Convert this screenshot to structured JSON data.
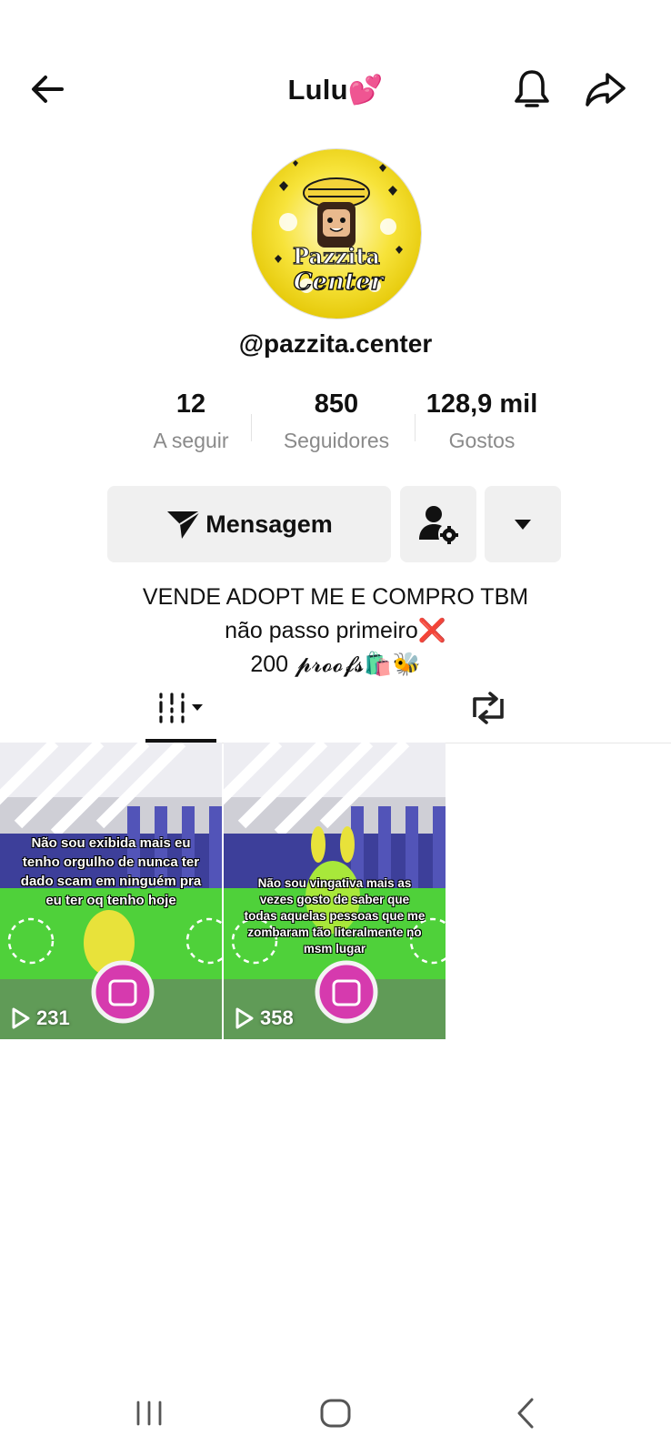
{
  "header": {
    "title": "Lulu💕",
    "back_icon": "arrow-left-icon",
    "bell_icon": "bell-icon",
    "share_icon": "share-arrow-icon"
  },
  "profile": {
    "avatar_text_line1": "Pazzita",
    "avatar_text_line2": "Center",
    "handle": "@pazzita.center"
  },
  "stats": [
    {
      "value": "12",
      "label": "A seguir"
    },
    {
      "value": "850",
      "label": "Seguidores"
    },
    {
      "value": "128,9 mil",
      "label": "Gostos"
    }
  ],
  "actions": {
    "message_label": "Mensagem",
    "message_icon": "send-icon",
    "follow_settings_icon": "user-settings-icon",
    "more_icon": "caret-down-icon"
  },
  "bio": {
    "line1": "VENDE ADOPT ME E COMPRO TBM",
    "line2": "não passo primeiro❌",
    "line3": "200 𝓹𝓻𝓸𝓸𝓯𝓼🛍️🐝"
  },
  "tabs": {
    "videos_icon": "grid-bars-icon",
    "reposts_icon": "repost-icon"
  },
  "videos": [
    {
      "caption": "Não sou exibida mais eu tenho orgulho de nunca ter dado scam em ninguém pra eu ter oq tenho hoje",
      "views": "231"
    },
    {
      "caption": "Não sou vingativa mais as vezes gosto de saber que todas aquelas pessoas que me zombaram tão literalmente no msm lugar",
      "views": "358"
    }
  ],
  "colors": {
    "button_bg": "#f0f0f0",
    "muted_text": "#8a8a8a",
    "game_green": "#4fd13a",
    "fence_purple": "#3d3f9a",
    "backpack_pink": "#d63aae"
  }
}
